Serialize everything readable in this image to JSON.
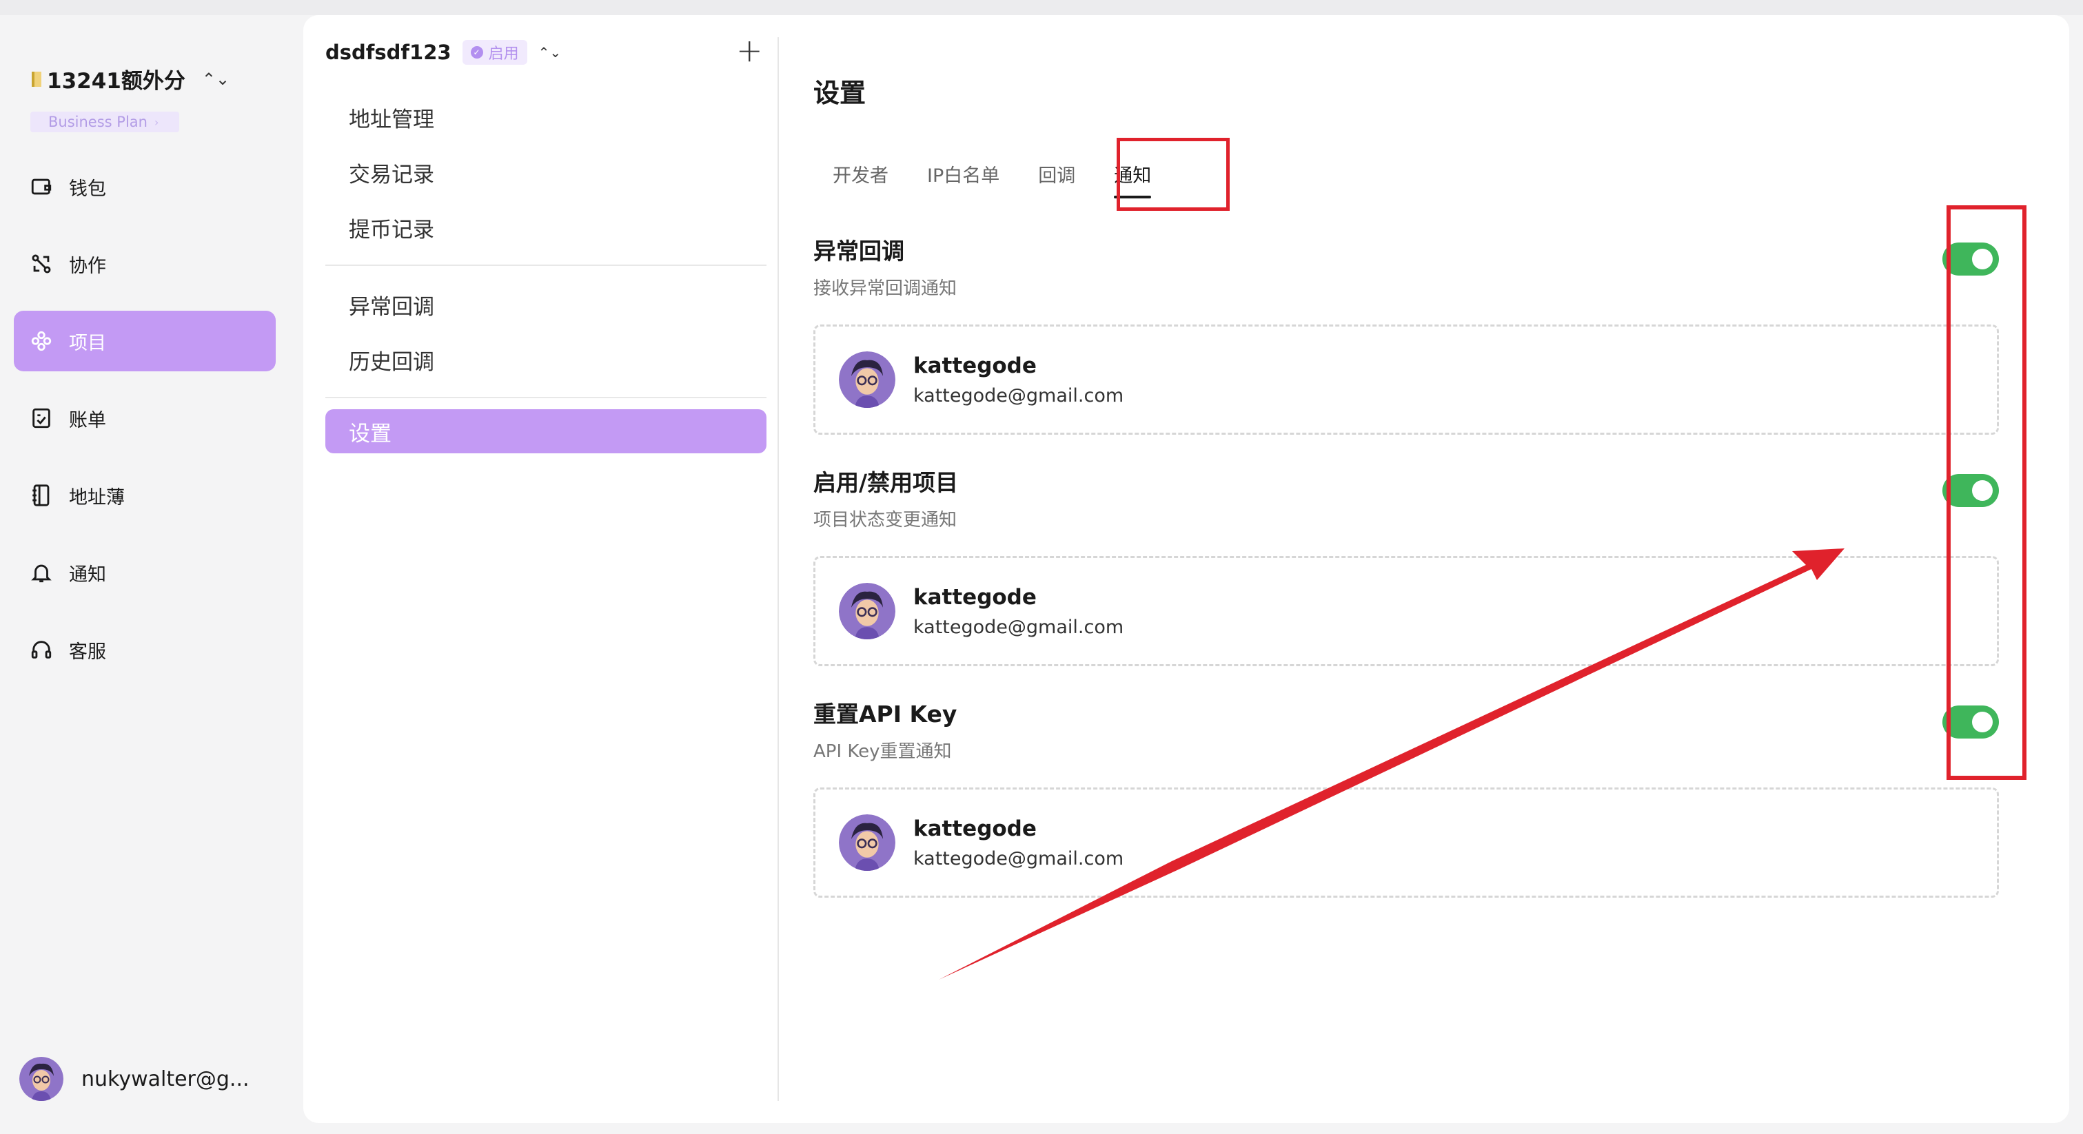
{
  "org": {
    "name": "13241额外分",
    "plan": "Business Plan",
    "plan_chevron": "›"
  },
  "nav": [
    {
      "label": "钱包",
      "icon": "wallet-icon"
    },
    {
      "label": "协作",
      "icon": "collaboration-icon"
    },
    {
      "label": "项目",
      "icon": "project-icon",
      "active": true
    },
    {
      "label": "账单",
      "icon": "bill-icon"
    },
    {
      "label": "地址薄",
      "icon": "address-book-icon"
    },
    {
      "label": "通知",
      "icon": "bell-icon"
    },
    {
      "label": "客服",
      "icon": "headset-icon"
    }
  ],
  "user": {
    "name": "nukywalter@g..."
  },
  "project": {
    "name": "dsdfsdf123",
    "status": "启用",
    "add_symbol": "+",
    "menu_group1": [
      "地址管理",
      "交易记录",
      "提币记录"
    ],
    "menu_group2": [
      "异常回调",
      "历史回调"
    ],
    "menu_group3": [
      "设置"
    ]
  },
  "settings": {
    "title": "设置",
    "tabs": [
      "开发者",
      "IP白名单",
      "回调",
      "通知"
    ],
    "active_tab": "通知",
    "sections": [
      {
        "title": "异常回调",
        "desc": "接收异常回调通知",
        "enabled": true,
        "member": {
          "name": "kattegode",
          "email": "kattegode@gmail.com"
        }
      },
      {
        "title": "启用/禁用项目",
        "desc": "项目状态变更通知",
        "enabled": true,
        "member": {
          "name": "kattegode",
          "email": "kattegode@gmail.com"
        }
      },
      {
        "title": "重置API Key",
        "desc": "API Key重置通知",
        "enabled": true,
        "member": {
          "name": "kattegode",
          "email": "kattegode@gmail.com"
        }
      }
    ]
  },
  "colors": {
    "accent": "#c39af4",
    "toggle_on": "#3fb65b",
    "annotation": "#e0222c"
  }
}
